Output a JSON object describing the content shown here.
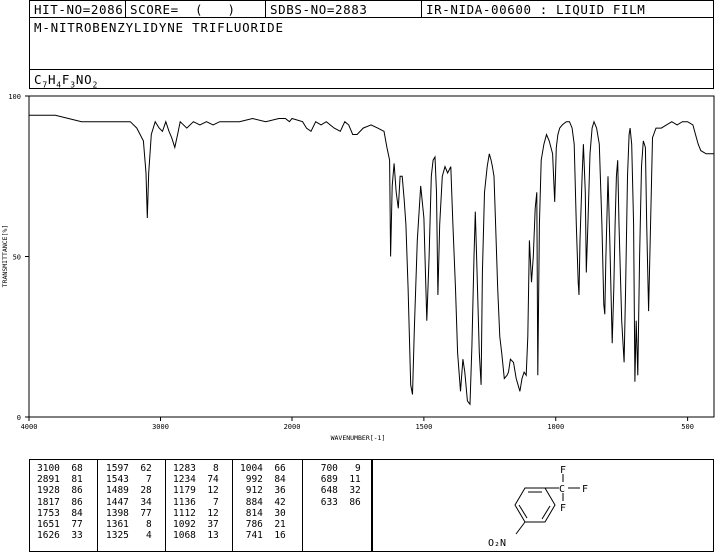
{
  "header": {
    "hit_no": "HIT-NO=2086",
    "score": "SCORE=  (   )",
    "sdbs_no": "SDBS-NO=2883",
    "technique": "IR-NIDA-00600 : LIQUID FILM"
  },
  "compound_name": "M-NITROBENZYLIDYNE TRIFLUORIDE",
  "formula": {
    "C": "C",
    "c_n": "7",
    "H": "H",
    "h_n": "4",
    "F": "F",
    "f_n": "3",
    "NO": "NO",
    "o_n": "2"
  },
  "chart_data": {
    "type": "line",
    "xlabel": "WAVENUMBER[-1]",
    "ylabel": "TRANSMITTANCE[%]",
    "xlim": [
      4000,
      400
    ],
    "ylim": [
      0,
      100
    ],
    "x_ticks": [
      "4000",
      "3000",
      "2000",
      "1500",
      "1000",
      "500"
    ],
    "y_ticks": [
      "100",
      "50",
      "0"
    ],
    "spectrum": [
      [
        4000,
        94
      ],
      [
        3900,
        94
      ],
      [
        3800,
        94
      ],
      [
        3700,
        93
      ],
      [
        3600,
        92
      ],
      [
        3500,
        92
      ],
      [
        3400,
        92
      ],
      [
        3300,
        92
      ],
      [
        3230,
        92
      ],
      [
        3180,
        90
      ],
      [
        3130,
        86
      ],
      [
        3110,
        76
      ],
      [
        3100,
        62
      ],
      [
        3090,
        76
      ],
      [
        3070,
        88
      ],
      [
        3040,
        92
      ],
      [
        3010,
        90
      ],
      [
        2985,
        89
      ],
      [
        2960,
        92
      ],
      [
        2935,
        89
      ],
      [
        2915,
        87
      ],
      [
        2891,
        84
      ],
      [
        2870,
        88
      ],
      [
        2850,
        92
      ],
      [
        2800,
        90
      ],
      [
        2750,
        92
      ],
      [
        2700,
        91
      ],
      [
        2650,
        92
      ],
      [
        2600,
        91
      ],
      [
        2550,
        92
      ],
      [
        2500,
        92
      ],
      [
        2400,
        92
      ],
      [
        2300,
        93
      ],
      [
        2200,
        92
      ],
      [
        2100,
        93
      ],
      [
        2050,
        93
      ],
      [
        2020,
        92
      ],
      [
        2000,
        93
      ],
      [
        1960,
        92
      ],
      [
        1945,
        90
      ],
      [
        1928,
        89
      ],
      [
        1910,
        92
      ],
      [
        1890,
        91
      ],
      [
        1870,
        92
      ],
      [
        1840,
        90
      ],
      [
        1817,
        89
      ],
      [
        1800,
        92
      ],
      [
        1785,
        91
      ],
      [
        1770,
        88
      ],
      [
        1753,
        88
      ],
      [
        1730,
        90
      ],
      [
        1700,
        91
      ],
      [
        1675,
        90
      ],
      [
        1651,
        89
      ],
      [
        1640,
        84
      ],
      [
        1630,
        80
      ],
      [
        1626,
        50
      ],
      [
        1620,
        72
      ],
      [
        1613,
        79
      ],
      [
        1605,
        70
      ],
      [
        1597,
        65
      ],
      [
        1590,
        75
      ],
      [
        1582,
        75
      ],
      [
        1575,
        68
      ],
      [
        1568,
        60
      ],
      [
        1560,
        40
      ],
      [
        1550,
        10
      ],
      [
        1543,
        7
      ],
      [
        1536,
        28
      ],
      [
        1525,
        55
      ],
      [
        1512,
        72
      ],
      [
        1500,
        62
      ],
      [
        1489,
        30
      ],
      [
        1480,
        50
      ],
      [
        1472,
        75
      ],
      [
        1465,
        80
      ],
      [
        1458,
        81
      ],
      [
        1452,
        70
      ],
      [
        1447,
        38
      ],
      [
        1440,
        60
      ],
      [
        1430,
        75
      ],
      [
        1420,
        78
      ],
      [
        1410,
        76
      ],
      [
        1398,
        78
      ],
      [
        1390,
        60
      ],
      [
        1380,
        40
      ],
      [
        1372,
        20
      ],
      [
        1361,
        8
      ],
      [
        1352,
        18
      ],
      [
        1345,
        14
      ],
      [
        1335,
        5
      ],
      [
        1325,
        4
      ],
      [
        1318,
        22
      ],
      [
        1310,
        50
      ],
      [
        1305,
        64
      ],
      [
        1300,
        50
      ],
      [
        1290,
        20
      ],
      [
        1283,
        10
      ],
      [
        1278,
        45
      ],
      [
        1270,
        70
      ],
      [
        1260,
        78
      ],
      [
        1252,
        82
      ],
      [
        1245,
        80
      ],
      [
        1240,
        78
      ],
      [
        1234,
        75
      ],
      [
        1228,
        60
      ],
      [
        1220,
        40
      ],
      [
        1212,
        25
      ],
      [
        1205,
        20
      ],
      [
        1195,
        12
      ],
      [
        1185,
        13
      ],
      [
        1179,
        14
      ],
      [
        1172,
        18
      ],
      [
        1160,
        17
      ],
      [
        1150,
        12
      ],
      [
        1136,
        8
      ],
      [
        1128,
        12
      ],
      [
        1120,
        14
      ],
      [
        1112,
        13
      ],
      [
        1106,
        25
      ],
      [
        1100,
        55
      ],
      [
        1092,
        42
      ],
      [
        1085,
        50
      ],
      [
        1078,
        65
      ],
      [
        1072,
        70
      ],
      [
        1068,
        13
      ],
      [
        1062,
        60
      ],
      [
        1055,
        80
      ],
      [
        1045,
        85
      ],
      [
        1035,
        88
      ],
      [
        1025,
        86
      ],
      [
        1012,
        82
      ],
      [
        1004,
        67
      ],
      [
        998,
        84
      ],
      [
        992,
        88
      ],
      [
        985,
        90
      ],
      [
        975,
        91
      ],
      [
        960,
        92
      ],
      [
        948,
        92
      ],
      [
        938,
        90
      ],
      [
        930,
        85
      ],
      [
        922,
        60
      ],
      [
        915,
        42
      ],
      [
        912,
        38
      ],
      [
        908,
        55
      ],
      [
        900,
        75
      ],
      [
        895,
        85
      ],
      [
        888,
        70
      ],
      [
        884,
        45
      ],
      [
        878,
        60
      ],
      [
        870,
        82
      ],
      [
        862,
        90
      ],
      [
        855,
        92
      ],
      [
        845,
        90
      ],
      [
        835,
        85
      ],
      [
        825,
        60
      ],
      [
        818,
        35
      ],
      [
        814,
        32
      ],
      [
        810,
        50
      ],
      [
        802,
        75
      ],
      [
        795,
        55
      ],
      [
        786,
        23
      ],
      [
        780,
        40
      ],
      [
        775,
        60
      ],
      [
        770,
        75
      ],
      [
        765,
        80
      ],
      [
        760,
        60
      ],
      [
        750,
        30
      ],
      [
        741,
        17
      ],
      [
        735,
        40
      ],
      [
        728,
        75
      ],
      [
        722,
        88
      ],
      [
        718,
        90
      ],
      [
        712,
        85
      ],
      [
        705,
        60
      ],
      [
        700,
        11
      ],
      [
        695,
        30
      ],
      [
        689,
        13
      ],
      [
        682,
        50
      ],
      [
        675,
        78
      ],
      [
        668,
        86
      ],
      [
        660,
        84
      ],
      [
        655,
        60
      ],
      [
        648,
        33
      ],
      [
        642,
        55
      ],
      [
        633,
        87
      ],
      [
        620,
        90
      ],
      [
        600,
        90
      ],
      [
        580,
        91
      ],
      [
        560,
        92
      ],
      [
        540,
        91
      ],
      [
        520,
        92
      ],
      [
        500,
        92
      ],
      [
        480,
        91
      ],
      [
        470,
        88
      ],
      [
        460,
        85
      ],
      [
        450,
        83
      ],
      [
        430,
        82
      ],
      [
        410,
        82
      ],
      [
        400,
        82
      ]
    ]
  },
  "peak_table": {
    "col1": "3100  68\n2891  81\n1928  86\n1817  86\n1753  84\n1651  77\n1626  33",
    "col2": "1597  62\n1543   7\n1489  28\n1447  34\n1398  77\n1361   8\n1325   4",
    "col3": "1283   8\n1234  74\n1179  12\n1136   7\n1112  12\n1092  37\n1068  13",
    "col4": "1004  66\n 992  84\n 912  36\n 884  42\n 814  30\n 786  21\n 741  16",
    "col5": " 700   9\n 689  11\n 648  32\n 633  86"
  },
  "structure": {
    "f_top": "F",
    "f_right": "F",
    "f_bottom": "F",
    "c_label": "C",
    "nitro_label": "O₂N"
  }
}
